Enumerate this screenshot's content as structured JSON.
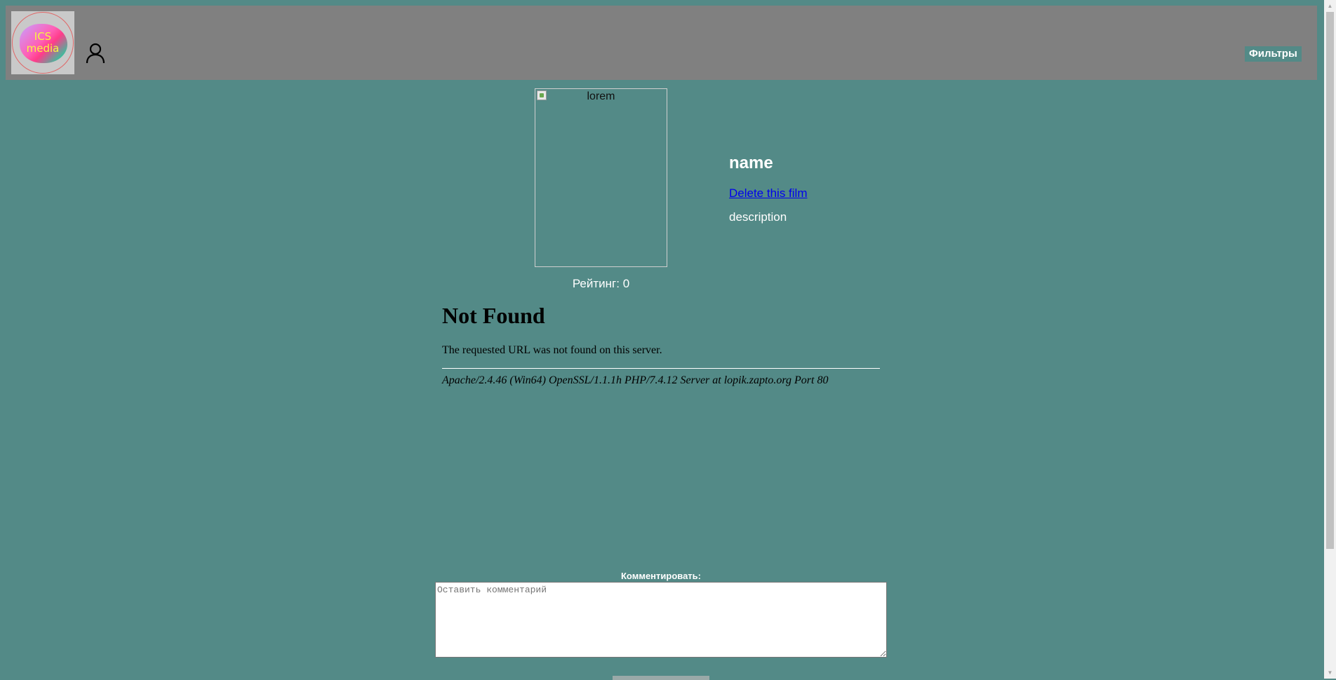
{
  "header": {
    "logo_text_line1": "ICS",
    "logo_text_line2": "media",
    "filters_label": "Фильтры"
  },
  "film": {
    "poster_alt": "lorem",
    "rating": "Рейтинг: 0",
    "name": "name",
    "delete_link": "Delete this film",
    "description": "description"
  },
  "error": {
    "title": "Not Found",
    "message": "The requested URL was not found on this server.",
    "server": "Apache/2.4.46 (Win64) OpenSSL/1.1.1h PHP/7.4.12 Server at lopik.zapto.org Port 80"
  },
  "comment": {
    "label": "Комментировать:",
    "placeholder": "Оставить комментарий"
  },
  "icons": {
    "user": "user-icon",
    "broken_image": "broken-image-icon",
    "scroll_up": "scroll-up-arrow-icon",
    "scroll_down": "scroll-down-arrow-icon"
  },
  "colors": {
    "page_background": "#538a87",
    "header_background": "#808080",
    "link": "#0000ee"
  }
}
